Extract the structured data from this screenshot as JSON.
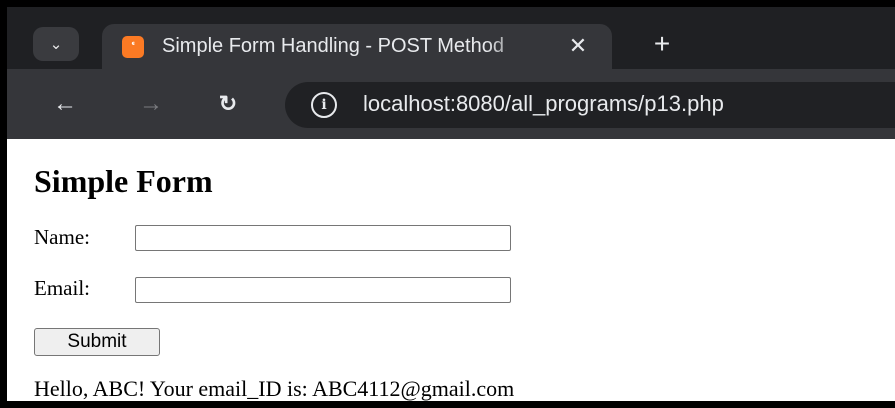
{
  "browser": {
    "tab": {
      "favicon_text": "ꙴ",
      "title": "Simple Form Handling - POST Method",
      "close_icon": "close-icon"
    },
    "new_tab_icon": "plus-icon",
    "toolbar": {
      "back_icon": "arrow-left-icon",
      "forward_icon": "arrow-right-icon",
      "reload_icon": "reload-icon",
      "site_info_icon": "info-icon",
      "url": "localhost:8080/all_programs/p13.php"
    }
  },
  "page": {
    "title": "Simple Form",
    "form": {
      "name_label": "Name:",
      "name_value": "",
      "email_label": "Email:",
      "email_value": "",
      "submit_label": "Submit"
    },
    "result_message": "Hello, ABC! Your email_ID is: ABC4112@gmail.com"
  },
  "colors": {
    "tabbar_bg": "#1f2023",
    "toolbar_bg": "#35363a",
    "omnibox_bg": "#202124",
    "favicon_accent": "#fb7a24"
  }
}
